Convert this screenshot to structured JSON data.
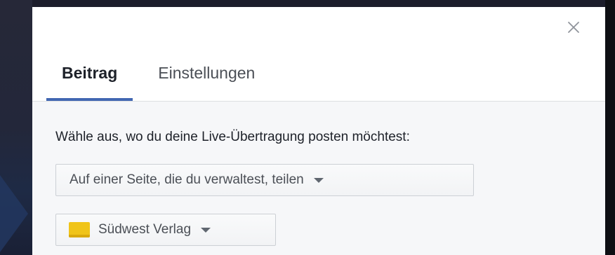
{
  "dialog": {
    "close_label": "×",
    "tabs": [
      {
        "label": "Beitrag",
        "active": true
      },
      {
        "label": "Einstellungen",
        "active": false
      }
    ],
    "prompt": "Wähle aus, wo du deine Live-Übertragung posten möchtest:",
    "share_target": {
      "selected": "Auf einer Seite, die du verwaltest, teilen"
    },
    "page_selector": {
      "selected": "Südwest Verlag"
    }
  },
  "colors": {
    "accent": "#4267b2",
    "text_primary": "#1d2129",
    "text_secondary": "#4b4f56",
    "body_background": "#f6f7f9",
    "page_thumb": "#f0c419"
  },
  "icons": {
    "close": "close-icon",
    "dropdown": "chevron-down-icon",
    "page": "page-avatar"
  }
}
